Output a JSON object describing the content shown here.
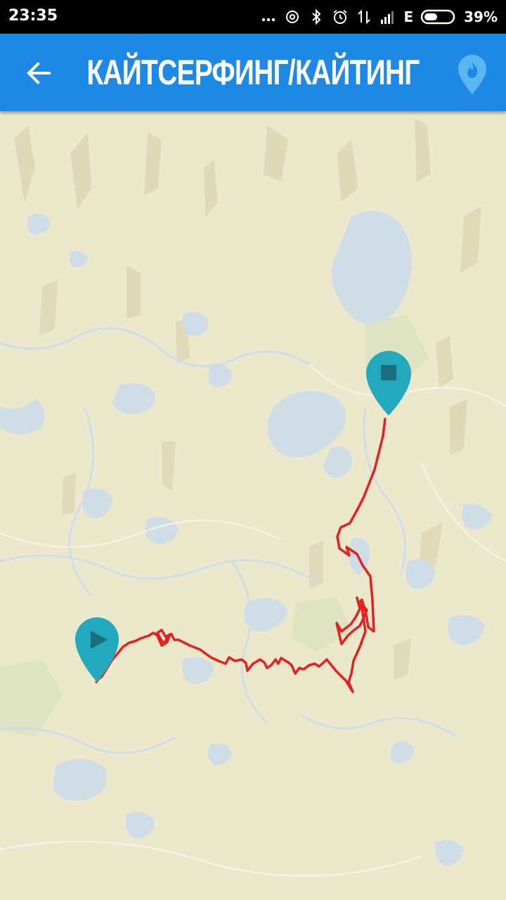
{
  "status_bar": {
    "time": "23:35",
    "network_type": "E",
    "battery": "39%",
    "icons": [
      "more-dots-icon",
      "sync-icon",
      "bluetooth-icon",
      "alarm-icon",
      "data-transfer-icon",
      "signal-icon",
      "battery-icon"
    ]
  },
  "app_bar": {
    "title": "КАЙТСЕРФИНГ/КАЙТИНГ",
    "back_icon": "arrow-back-icon",
    "action_icon": "location-flame-pin-icon"
  },
  "map": {
    "start_marker_icon": "play-icon",
    "end_marker_icon": "stop-icon",
    "colors": {
      "land": "#ECE8CC",
      "water": "#CFDDE6",
      "route": "#E52020",
      "marker": "#22A9BE",
      "appbar": "#1E88E5"
    }
  }
}
